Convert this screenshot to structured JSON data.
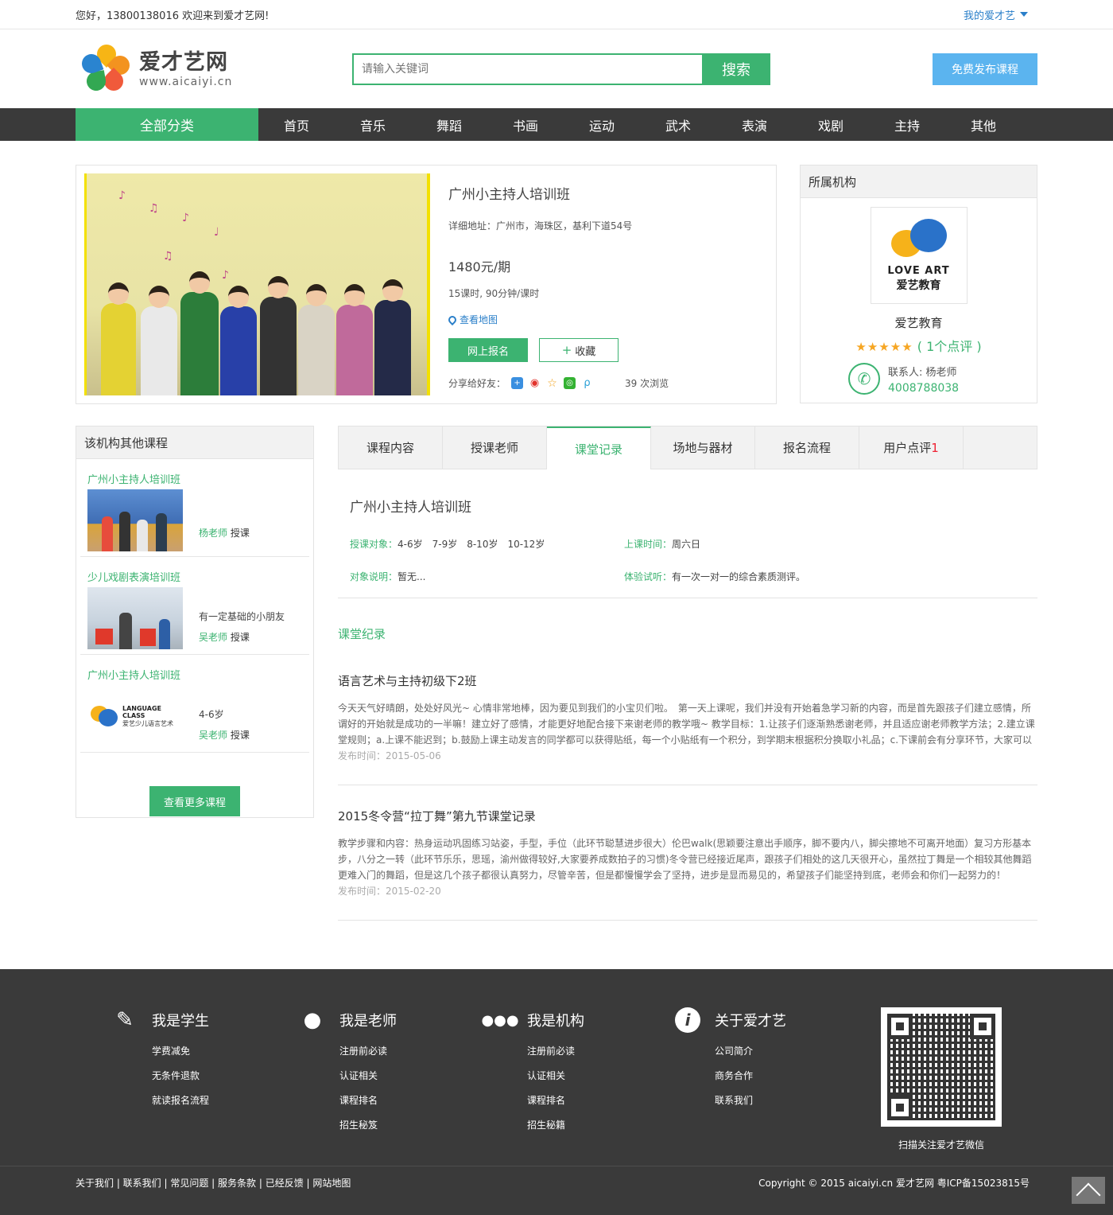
{
  "topbar": {
    "welcome": "您好，13800138016 欢迎来到爱才艺网!",
    "mine": "我的爱才艺"
  },
  "logo": {
    "cn": "爱才艺网",
    "en": "www.aicaiyi.cn"
  },
  "search": {
    "placeholder": "请输入关键词",
    "button": "搜索"
  },
  "publish": "免费发布课程",
  "nav": {
    "all": "全部分类",
    "items": [
      "首页",
      "音乐",
      "舞蹈",
      "书画",
      "运动",
      "武术",
      "表演",
      "戏剧",
      "主持",
      "其他"
    ]
  },
  "course": {
    "title": "广州小主持人培训班",
    "address": "详细地址：广州市，海珠区，基利下道54号",
    "price": "1480元/期",
    "hours": "15课时, 90分钟/课时",
    "map": "查看地图",
    "enroll": "网上报名",
    "favorite": "收藏",
    "share_label": "分享给好友：",
    "views": "39 次浏览"
  },
  "org": {
    "header": "所属机构",
    "logo_en": "LOVE ART",
    "logo_cn": "爱艺教育",
    "name": "爱艺教育",
    "stars": "★★★★★",
    "rating": "( 1个点评 )",
    "contact": "联系人: 杨老师",
    "phone": "4008788038"
  },
  "side": {
    "header": "该机构其他课程",
    "items": [
      {
        "title": "广州小主持人培训班",
        "desc": "",
        "teacher": "杨老师",
        "suffix": " 授课"
      },
      {
        "title": "少儿戏剧表演培训班",
        "desc": "有一定基础的小朋友",
        "teacher": "吴老师",
        "suffix": " 授课"
      },
      {
        "title": "广州小主持人培训班",
        "desc": "4-6岁",
        "teacher": "吴老师",
        "suffix": " 授课"
      }
    ],
    "more": "查看更多课程",
    "thumb3_en": "LANGUAGE CLASS",
    "thumb3_cn": "爱艺少儿语言艺术"
  },
  "tabs": [
    "课程内容",
    "授课老师",
    "课堂记录",
    "场地与器材",
    "报名流程",
    "用户点评"
  ],
  "tab_count": "1",
  "detail": {
    "title": "广州小主持人培训班",
    "target_label": "授课对象：",
    "target": "4-6岁　7-9岁　8-10岁　10-12岁",
    "time_label": "上课时间：",
    "time": "周六日",
    "note_label": "对象说明：",
    "note": "暂无...",
    "trial_label": "体验试听：",
    "trial": "有一次一对一的综合素质测评。"
  },
  "records_title": "课堂纪录",
  "records": [
    {
      "title": "语言艺术与主持初级下2班",
      "body": "今天天气好晴朗，处处好风光~ 心情非常地棒，因为要见到我们的小宝贝们啦。　第一天上课呢，我们并没有开始着急学习新的内容，而是首先跟孩子们建立感情，所谓好的开始就是成功的一半嘛！建立好了感情，才能更好地配合接下来谢老师的教学哦~ 教学目标：1.让孩子们逐渐熟悉谢老师，并且适应谢老师教学方法；2.建立课堂规则；a.上课不能迟到；b.鼓励上课主动发言的同学都可以获得贴纸，每一个小贴纸有一个积分，到学期末根据积分换取小礼品；c.下课前会有分享环节，大家可以",
      "date": "发布时间：2015-05-06"
    },
    {
      "title": "2015冬令营“拉丁舞”第九节课堂记录",
      "body": "教学步骤和内容：热身运动巩固练习站姿，手型，手位（此环节聪慧进步很大）伦巴walk(思颖要注意出手顺序，脚不要内八，脚尖擦地不可离开地面）复习方形基本步，八分之一转（此环节乐乐，思瑶，渝州做得较好,大家要养成数拍子的习惯)冬令营已经接近尾声，跟孩子们相处的这几天很开心，虽然拉丁舞是一个相较其他舞蹈更难入门的舞蹈，但是这几个孩子都很认真努力，尽管辛苦，但是都慢慢学会了坚持，进步是显而易见的，希望孩子们能坚持到底，老师会和你们一起努力的！",
      "date": "发布时间：2015-02-20"
    }
  ],
  "footer": {
    "cols": [
      {
        "title": "我是学生",
        "links": [
          "学费减免",
          "无条件退款",
          "就读报名流程"
        ]
      },
      {
        "title": "我是老师",
        "links": [
          "注册前必读",
          "认证相关",
          "课程排名",
          "招生秘笈"
        ]
      },
      {
        "title": "我是机构",
        "links": [
          "注册前必读",
          "认证相关",
          "课程排名",
          "招生秘籍"
        ]
      },
      {
        "title": "关于爱才艺",
        "links": [
          "公司简介",
          "商务合作",
          "联系我们"
        ]
      }
    ],
    "qr_caption": "扫描关注爱才艺微信",
    "bottom_links": "关于我们 |  联系我们 |  常见问题 |  服务条款 |  已经反馈 |  网站地图",
    "copyright": "Copyright © 2015 aicaiyi.cn 爱才艺网 粤ICP备15023815号"
  }
}
